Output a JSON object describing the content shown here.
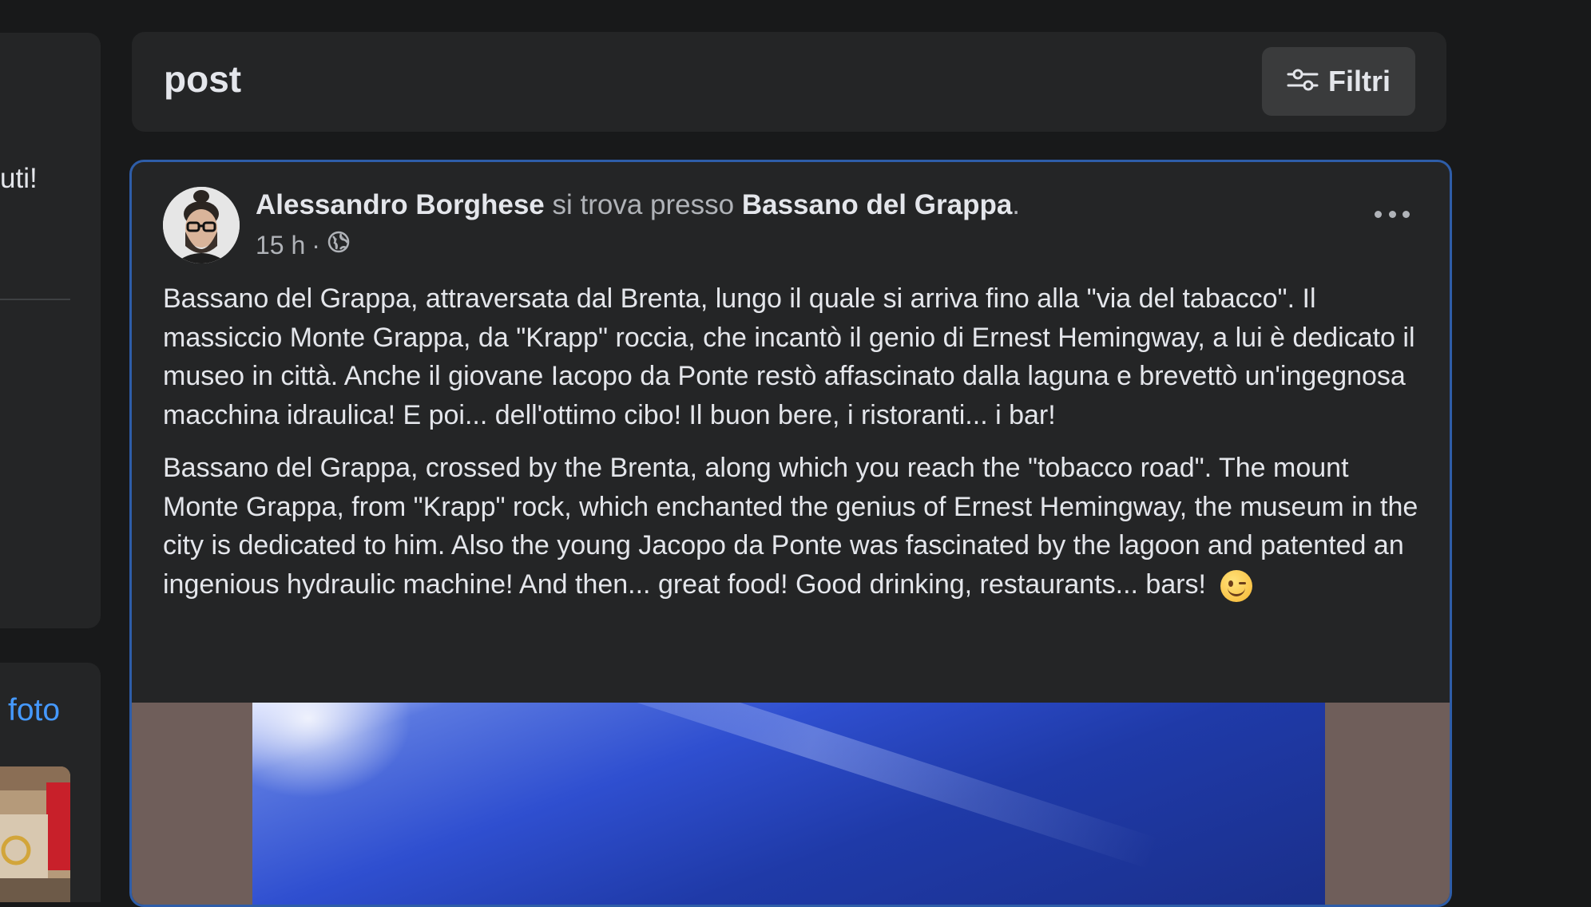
{
  "left_panel": {
    "snippet_text": "uti!",
    "photos_link": "foto"
  },
  "header": {
    "title": "post",
    "filters_label": "Filtri"
  },
  "post": {
    "author": "Alessandro Borghese",
    "location_prefix": "si trova presso",
    "location": "Bassano del Grappa",
    "location_suffix": ".",
    "time": "15 h",
    "separator": "·",
    "privacy_icon": "globe-icon",
    "text_it": "Bassano del Grappa, attraversata dal Brenta, lungo il quale si arriva fino alla \"via del tabacco\". Il massiccio Monte Grappa, da \"Krapp\" roccia, che incantò il genio di Ernest Hemingway, a lui è dedicato il museo in città. Anche il giovane Iacopo da Ponte restò affascinato dalla laguna e brevettò un'ingegnosa macchina idraulica! E poi... dell'ottimo cibo! Il buon bere, i ristoranti... i bar!",
    "text_en": "Bassano del Grappa, crossed by the Brenta, along which you reach the \"tobacco road\". The mount Monte Grappa, from \"Krapp\" rock, which enchanted the genius of Ernest Hemingway, the museum in the city is dedicated to him. Also the young Jacopo da Ponte was fascinated by the lagoon and patented an ingenious hydraulic machine! And then... great food! Good drinking, restaurants... bars!",
    "emoji": "winking-face"
  },
  "colors": {
    "background": "#18191a",
    "card": "#242526",
    "accent_border": "#2e5da8",
    "link": "#4599ff"
  }
}
